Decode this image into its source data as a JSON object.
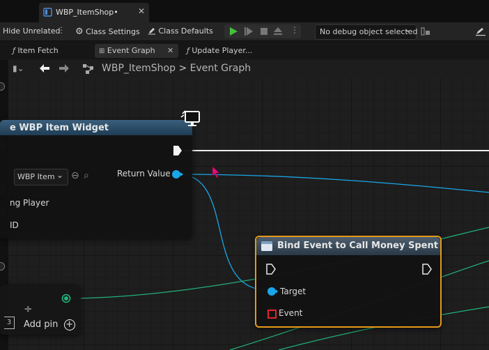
{
  "window": {
    "doc_tab": "WBP_ItemShop•"
  },
  "toolbar": {
    "hide_unrelated": "Hide Unrelated",
    "class_settings": "Class Settings",
    "class_defaults": "Class Defaults",
    "debug_dropdown": "No debug object selected"
  },
  "tabs": [
    {
      "label": "Item Fetch"
    },
    {
      "label": "Event Graph"
    },
    {
      "label": "Update Player..."
    }
  ],
  "breadcrumb": {
    "blueprint": "WBP_ItemShop",
    "separator": ">",
    "graph": "Event Graph"
  },
  "nodes": {
    "create_widget": {
      "title": "e WBP Item Widget",
      "class_value": "WBP Item",
      "return_value": "Return Value",
      "owning_player": "ng Player",
      "id": "ID"
    },
    "bind_event": {
      "title": "Bind Event to Call Money Spent",
      "target": "Target",
      "event": "Event"
    },
    "make_array": {
      "add_pin": "Add pin"
    }
  },
  "colors": {
    "exec_wire": "#f0f0f0",
    "object_wire": "#1aa7e8",
    "struct_wire": "#21b37a",
    "delegate_pin": "#e0262a",
    "selection_outline": "#e49a1a"
  }
}
